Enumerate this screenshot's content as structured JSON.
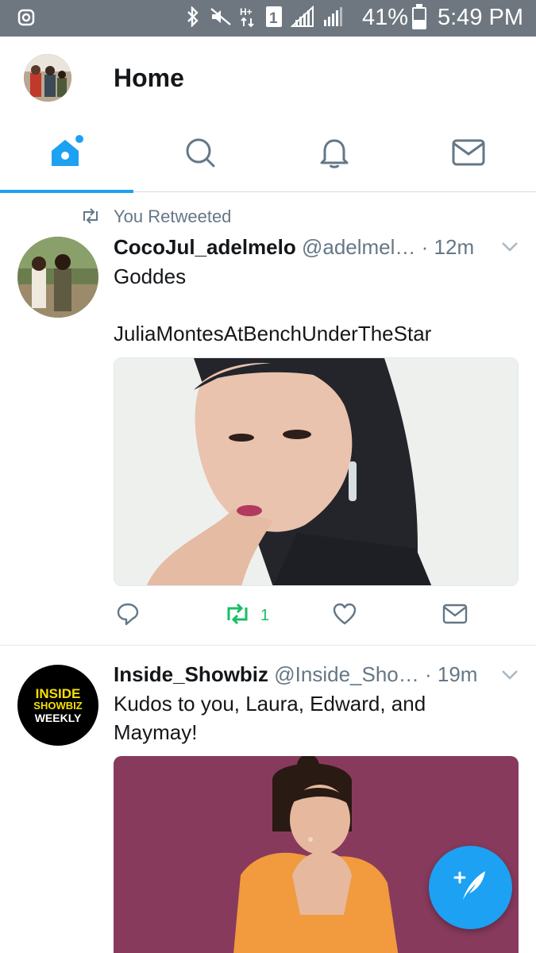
{
  "status_bar": {
    "battery_text": "41%",
    "time_text": "5:49 PM",
    "network_label": "1",
    "icons": [
      "instagram-icon",
      "bluetooth-icon",
      "mute-icon",
      "hplus-data-icon",
      "sim-icon",
      "signal-icon",
      "signal-icon",
      "battery-icon"
    ]
  },
  "header": {
    "title": "Home"
  },
  "tabs": [
    {
      "name": "home",
      "icon": "home-icon",
      "active": true
    },
    {
      "name": "search",
      "icon": "search-icon",
      "active": false
    },
    {
      "name": "notifications",
      "icon": "bell-icon",
      "active": false
    },
    {
      "name": "messages",
      "icon": "mail-icon",
      "active": false
    }
  ],
  "colors": {
    "accent": "#1da1f2",
    "retweet_green": "#17bf63",
    "secondary_text": "#657786",
    "status_bar": "#6e7780"
  },
  "tweets": [
    {
      "context": "You Retweeted",
      "name": "CocoJul_adelmelo",
      "handle": "@adelmel…",
      "time": "· 12m",
      "text": "Goddes\n\nJuliaMontesAtBenchUnderTheStar",
      "retweet_count": "1",
      "retweeted": true
    },
    {
      "name": "Inside_Showbiz",
      "handle": "@Inside_Sho…",
      "time": "· 19m",
      "text": "Kudos to you, Laura, Edward, and Maymay!",
      "avatar_text_1": "INSIDE",
      "avatar_text_2": "SHOWBIZ",
      "avatar_text_3": "WEEKLY"
    }
  ]
}
